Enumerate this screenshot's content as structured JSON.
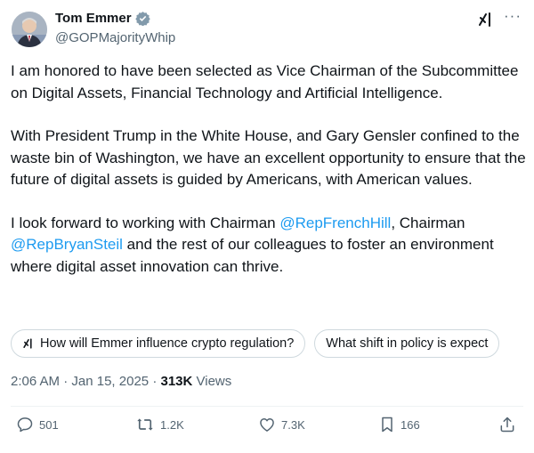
{
  "author": {
    "name": "Tom Emmer",
    "handle": "@GOPMajorityWhip"
  },
  "tweet": {
    "para1": "I am honored to have been selected as Vice Chairman of the Subcommittee on Digital Assets, Financial Technology and Artificial Intelligence.",
    "para2": "With President Trump in the White House, and Gary Gensler confined to the waste bin of Washington, we have an excellent opportunity to ensure that the future of digital assets is guided by Americans, with American values.",
    "para3_a": "I look forward to working with Chairman ",
    "mention1": "@RepFrenchHill",
    "para3_b": ", Chairman ",
    "mention2": "@RepBryanSteil",
    "para3_c": " and the rest of our colleagues to foster an environment where digital asset innovation can thrive."
  },
  "grok_chips": [
    "How will Emmer influence crypto regulation?",
    "What shift in policy is expect"
  ],
  "meta": {
    "time": "2:06 AM",
    "date": "Jan 15, 2025",
    "views_count": "313K",
    "views_label": " Views"
  },
  "actions": {
    "replies": "501",
    "reposts": "1.2K",
    "likes": "7.3K",
    "bookmarks": "166"
  },
  "colors": {
    "accent": "#1d9bf0",
    "text": "#0f1419",
    "secondary": "#536471"
  },
  "icons": [
    "verified-badge-icon",
    "grok-icon",
    "more-icon",
    "reply-icon",
    "repost-icon",
    "like-icon",
    "bookmark-icon",
    "share-icon"
  ]
}
